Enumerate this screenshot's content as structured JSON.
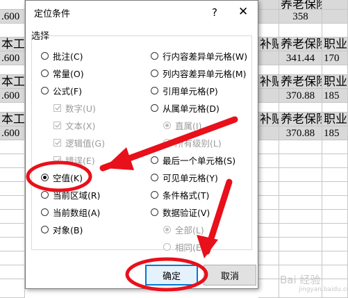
{
  "sheet": {
    "rows": [
      {
        "col_a": "",
        "col_d": "养老保险",
        "col_e": "358",
        "col_f": ""
      },
      {
        "col_a": ".600",
        "col_d": "",
        "col_e": "",
        "col_f": ""
      },
      {
        "col_a": "本工资",
        "col_c": "补贴",
        "col_d": "养老保险",
        "col_e": "",
        "col_f": "职业"
      },
      {
        "col_a": ".600",
        "col_d": "341.44",
        "col_e": "",
        "col_f": "170"
      },
      {
        "col_a": "本工资",
        "col_c": "补贴",
        "col_d": "养老保险",
        "col_e": "",
        "col_f": "职业"
      },
      {
        "col_a": ".600",
        "col_d": "370.88",
        "col_e": "",
        "col_f": "185"
      },
      {
        "col_a": "本工资",
        "col_c": "补贴",
        "col_d": "养老保险",
        "col_e": "",
        "col_f": "职业"
      },
      {
        "col_a": ".600",
        "col_d": "370.88",
        "col_e": "",
        "col_f": "185"
      }
    ]
  },
  "dialog": {
    "title": "定位条件",
    "help": "?",
    "close": "✕",
    "section_label": "选择",
    "left_options": [
      {
        "label": "批注(C)",
        "type": "radio",
        "checked": false,
        "disabled": false
      },
      {
        "label": "常量(O)",
        "type": "radio",
        "checked": false,
        "disabled": false
      },
      {
        "label": "公式(F)",
        "type": "radio",
        "checked": false,
        "disabled": false
      },
      {
        "label": "数字(U)",
        "type": "check",
        "disabled": true
      },
      {
        "label": "文本(X)",
        "type": "check",
        "disabled": true
      },
      {
        "label": "逻辑值(G)",
        "type": "check",
        "disabled": true
      },
      {
        "label": "错误(E)",
        "type": "check",
        "disabled": true
      },
      {
        "label": "空值(K)",
        "type": "radio",
        "checked": true,
        "disabled": false
      },
      {
        "label": "当前区域(R)",
        "type": "radio",
        "checked": false,
        "disabled": false
      },
      {
        "label": "当前数组(A)",
        "type": "radio",
        "checked": false,
        "disabled": false
      },
      {
        "label": "对象(B)",
        "type": "radio",
        "checked": false,
        "disabled": false
      }
    ],
    "right_options": [
      {
        "label": "行内容差异单元格(W)",
        "type": "radio",
        "checked": false,
        "disabled": false
      },
      {
        "label": "列内容差异单元格(M)",
        "type": "radio",
        "checked": false,
        "disabled": false
      },
      {
        "label": "引用单元格(P)",
        "type": "radio",
        "checked": false,
        "disabled": false
      },
      {
        "label": "从属单元格(D)",
        "type": "radio",
        "checked": false,
        "disabled": false
      },
      {
        "label": "直属(I)",
        "type": "radio",
        "checked": true,
        "disabled": true
      },
      {
        "label": "所有级别(L)",
        "type": "radio",
        "checked": false,
        "disabled": true
      },
      {
        "label": "最后一个单元格(S)",
        "type": "radio",
        "checked": false,
        "disabled": false
      },
      {
        "label": "可见单元格(Y)",
        "type": "radio",
        "checked": false,
        "disabled": false
      },
      {
        "label": "条件格式(T)",
        "type": "radio",
        "checked": false,
        "disabled": false
      },
      {
        "label": "数据验证(V)",
        "type": "radio",
        "checked": false,
        "disabled": false
      },
      {
        "label": "全部(L)",
        "type": "radio",
        "checked": true,
        "disabled": true
      },
      {
        "label": "相同(E)",
        "type": "radio",
        "checked": false,
        "disabled": true
      }
    ],
    "ok_label": "确定",
    "cancel_label": "取消"
  },
  "watermark": {
    "text": "Bai 经验",
    "sub": "jingyan.baidu.com"
  },
  "colors": {
    "annotation_red": "#e8101b",
    "dialog_border": "#7a7a7a",
    "default_button_border": "#0078d7",
    "header_fill": "#d9d9d9"
  },
  "icons": [
    "close-icon",
    "help-icon",
    "arrow-icon",
    "highlight-ellipse-icon"
  ]
}
